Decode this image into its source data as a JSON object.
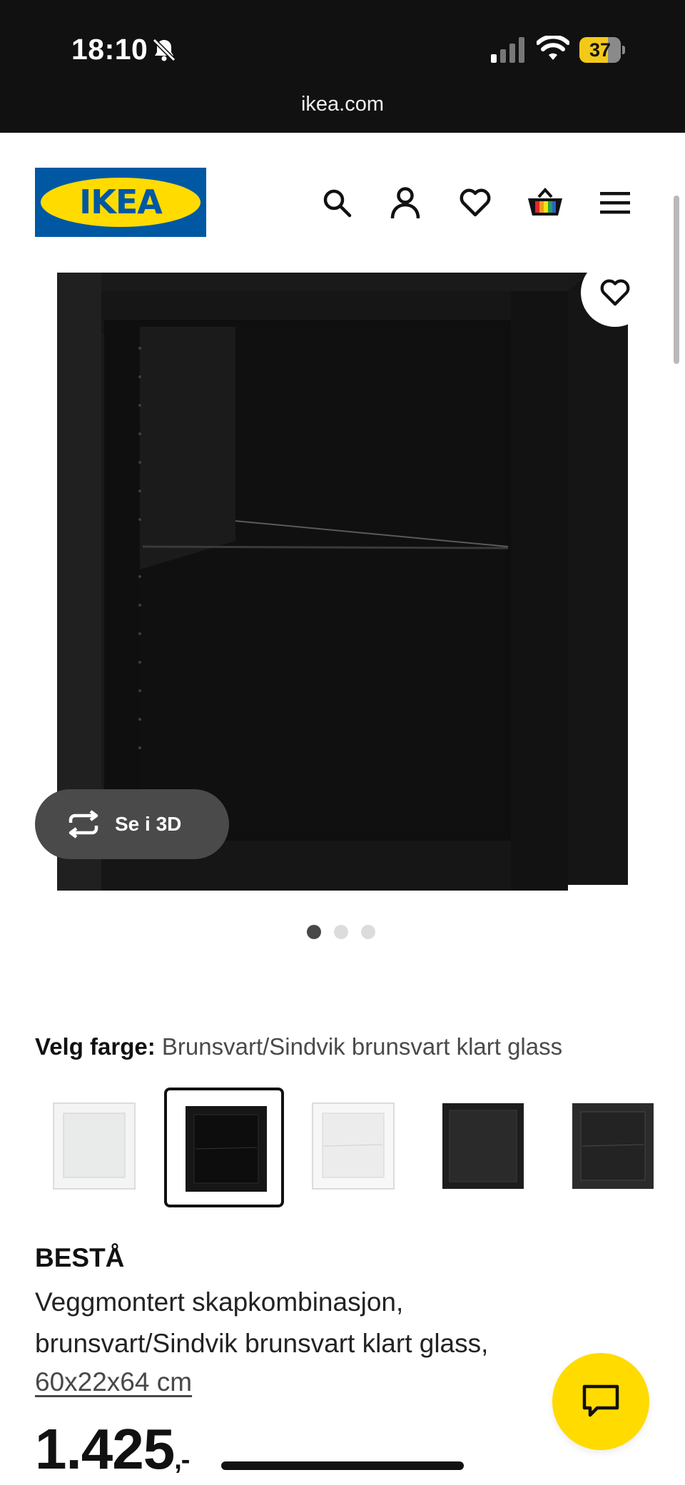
{
  "status_bar": {
    "time": "18:10",
    "battery": "37",
    "url": "ikea.com"
  },
  "header": {
    "logo_text": "IKEA",
    "icons": [
      "search-icon",
      "account-icon",
      "heart-icon",
      "cart-icon",
      "menu-icon"
    ]
  },
  "gallery": {
    "see_3d_label": "Se i 3D",
    "slide_count": 3,
    "active_slide": 1
  },
  "color_picker": {
    "label": "Velg farge:",
    "selected_value": "Brunsvart/Sindvik brunsvart klart glass",
    "options_count": 5,
    "selected_index": 1
  },
  "product": {
    "name": "BESTÅ",
    "description": "Veggmontert skapkombinasjon, brunsvart/Sindvik brunsvart klart glass,",
    "size": "60x22x64 cm",
    "price": "1.425",
    "price_suffix": ",-"
  },
  "colors": {
    "ikea_blue": "#0058a3",
    "ikea_yellow": "#ffdb00",
    "status_bar_bg": "#111111"
  }
}
